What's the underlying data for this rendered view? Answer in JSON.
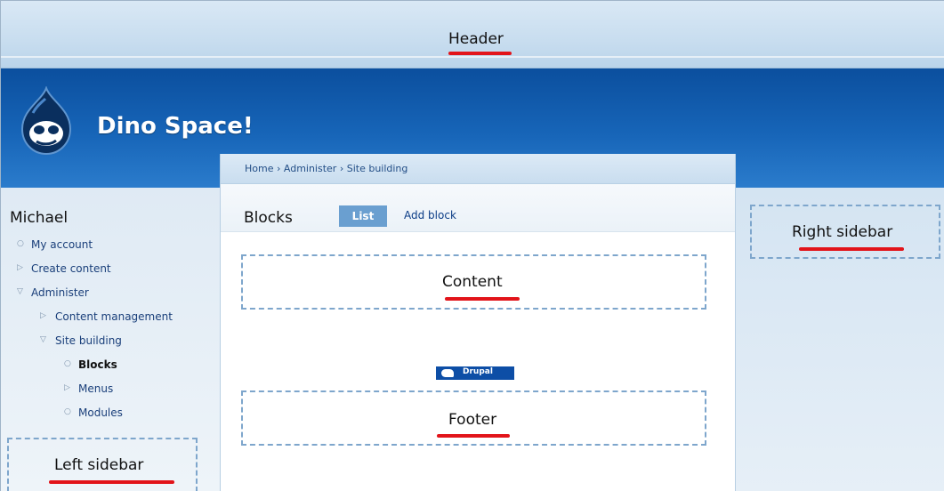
{
  "annotations": {
    "header": "Header",
    "content": "Content",
    "footer": "Footer",
    "left_sidebar": "Left sidebar",
    "right_sidebar": "Right sidebar"
  },
  "site": {
    "name": "Dino Space!",
    "logo_icon": "drupal-drop-icon"
  },
  "breadcrumb": "Home › Administer › Site building",
  "page": {
    "title": "Blocks",
    "tabs": [
      {
        "label": "List",
        "active": true
      },
      {
        "label": "Add block",
        "active": false
      }
    ]
  },
  "badge": {
    "label": "Drupal",
    "icon": "drupal-logo-icon"
  },
  "sidebar": {
    "user": "Michael",
    "menu": [
      {
        "label": "My account",
        "bullet": "○"
      },
      {
        "label": "Create content",
        "bullet": "▷"
      },
      {
        "label": "Administer",
        "bullet": "▽"
      },
      {
        "label": "Content management",
        "bullet": "▷"
      },
      {
        "label": "Site building",
        "bullet": "▽"
      },
      {
        "label": "Blocks",
        "bullet": "○"
      },
      {
        "label": "Menus",
        "bullet": "▷"
      },
      {
        "label": "Modules",
        "bullet": "○"
      }
    ]
  },
  "colors": {
    "banner": "#1765b8",
    "link": "#1a3f7a",
    "annotation_underline": "#e2141a",
    "dashed_region": "#7ea6cc",
    "active_tab": "#6a9fd0"
  }
}
